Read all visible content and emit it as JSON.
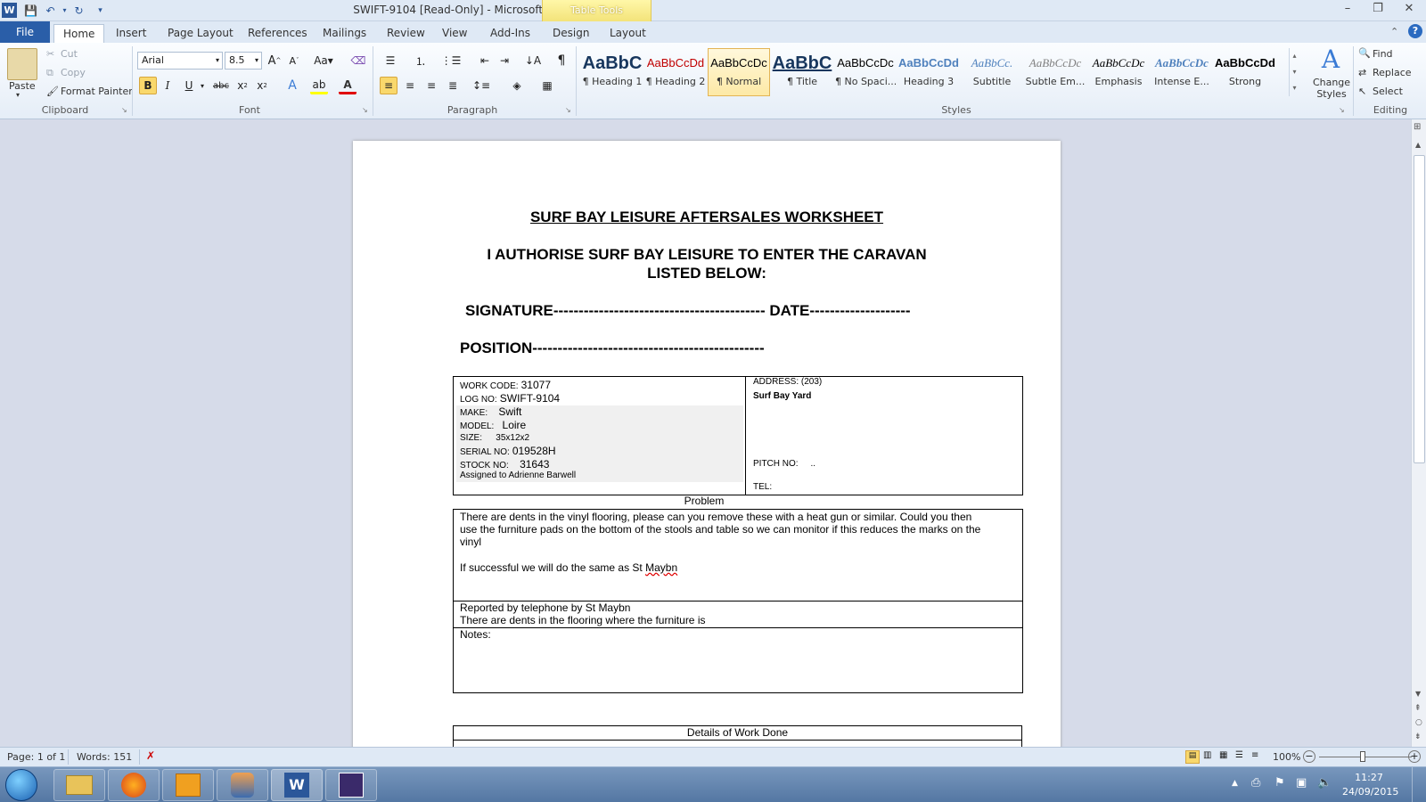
{
  "titlebar": {
    "title": "SWIFT-9104 [Read-Only] - Microsoft Word",
    "contextual": "Table Tools"
  },
  "tabs": {
    "file": "File",
    "home": "Home",
    "insert": "Insert",
    "page_layout": "Page Layout",
    "references": "References",
    "mailings": "Mailings",
    "review": "Review",
    "view": "View",
    "addins": "Add-Ins",
    "design": "Design",
    "layout": "Layout"
  },
  "clipboard": {
    "paste": "Paste",
    "cut": "Cut",
    "copy": "Copy",
    "format_painter": "Format Painter",
    "label": "Clipboard"
  },
  "font": {
    "name": "Arial",
    "size": "8.5",
    "label": "Font"
  },
  "paragraph": {
    "label": "Paragraph"
  },
  "styles": {
    "label": "Styles",
    "items": [
      {
        "sample": "AaBbC",
        "name": "¶ Heading 1"
      },
      {
        "sample": "AaBbCcDd",
        "name": "¶ Heading 2"
      },
      {
        "sample": "AaBbCcDc",
        "name": "¶ Normal"
      },
      {
        "sample": "AaBbC",
        "name": "¶ Title"
      },
      {
        "sample": "AaBbCcDc",
        "name": "¶ No Spaci..."
      },
      {
        "sample": "AaBbCcDd",
        "name": "Heading 3"
      },
      {
        "sample": "AaBbCc.",
        "name": "Subtitle"
      },
      {
        "sample": "AaBbCcDc",
        "name": "Subtle Em..."
      },
      {
        "sample": "AaBbCcDc",
        "name": "Emphasis"
      },
      {
        "sample": "AaBbCcDc",
        "name": "Intense E..."
      },
      {
        "sample": "AaBbCcDd",
        "name": "Strong"
      }
    ],
    "change_styles": "Change Styles"
  },
  "editing": {
    "find": "Find",
    "replace": "Replace",
    "select": "Select",
    "label": "Editing"
  },
  "doc": {
    "heading": "SURF BAY LEISURE AFTERSALES WORKSHEET",
    "authorise_1": "I AUTHORISE SURF BAY LEISURE TO ENTER THE CARAVAN",
    "authorise_2": "LISTED BELOW:",
    "signature": "SIGNATURE------------------------------------------ DATE--------------------",
    "position": "POSITION----------------------------------------------",
    "work_code_label": "WORK CODE:",
    "work_code": "31077",
    "log_no_label": "LOG NO:",
    "log_no": "SWIFT-9104",
    "make_label": "MAKE:",
    "make": "Swift",
    "model_label": "MODEL:",
    "model": "Loire",
    "size_label": "SIZE:",
    "size": "35x12x2",
    "serial_label": "SERIAL  NO:",
    "serial": "019528H",
    "stock_label": "STOCK NO:",
    "stock": "31643",
    "assigned": "Assigned to Adrienne Barwell",
    "address_label": "ADDRESS:  (203)",
    "address": "Surf Bay Yard",
    "pitch_label": "PITCH NO:",
    "pitch": "..",
    "tel_label": "TEL:",
    "problem_heading": "Problem",
    "problem_1": "There are dents in the vinyl flooring, please can you remove these with a heat gun or similar.  Could you then",
    "problem_2": "use the furniture pads on the bottom of the stools and table so we can monitor if this reduces the marks on the",
    "problem_3": "vinyl",
    "problem_4a": "If successful we will do the same as St ",
    "problem_4b": "Maybn",
    "reported_1": "Reported by telephone by St Maybn",
    "reported_2": "There are dents in the flooring where the furniture is",
    "notes": "Notes:",
    "work_done": "Details of Work Done"
  },
  "status": {
    "page": "Page: 1 of 1",
    "words": "Words: 151",
    "zoom": "100%"
  },
  "taskbar": {
    "time": "11:27",
    "date": "24/09/2015"
  }
}
